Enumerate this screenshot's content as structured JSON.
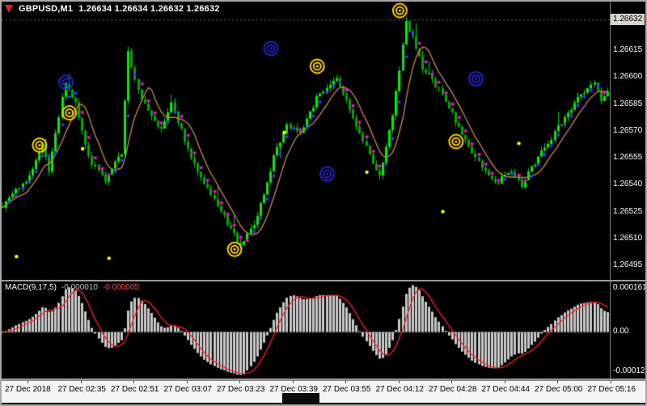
{
  "window": {
    "symbol_title": "GBPUSD,M1",
    "ohlc_title": "1.26634 1.26634 1.26632 1.26632"
  },
  "colors": {
    "background": "#000000",
    "bull": "#00ef00",
    "bear": "#00a800",
    "wick": "#00c800",
    "ma_line": "#c08050",
    "dot_up": "#2b3cff",
    "dot_down": "#ff00e0",
    "bullseye_yellow": "#ffd400",
    "bullseye_blue": "#2424cc",
    "yellow_dot": "#ffff00",
    "macd_hist": "#c8c8c8",
    "macd_signal": "#ff2020",
    "bid_line": "#6f6f6f",
    "axis_text": "#ffffff",
    "time_text": "#000000"
  },
  "chart_data": {
    "type": "candlestick",
    "title": "GBPUSD,M1",
    "symbol": "GBPUSD",
    "timeframe": "M1",
    "bars": 184,
    "bid": "1.26632",
    "p_max": 1.26642,
    "p_min": 1.26487,
    "noise_seed": 9,
    "price_grid": [
      "1.26615",
      "1.26600",
      "1.26585",
      "1.26570",
      "1.26555",
      "1.26540",
      "1.26525",
      "1.26510",
      "1.26495"
    ],
    "price_keyframes": [
      [
        0,
        1.26528
      ],
      [
        8,
        1.26545
      ],
      [
        12,
        1.26562
      ],
      [
        14,
        1.26548
      ],
      [
        19,
        1.26598
      ],
      [
        22,
        1.26585
      ],
      [
        26,
        1.26555
      ],
      [
        31,
        1.26542
      ],
      [
        36,
        1.26558
      ],
      [
        38,
        1.26615
      ],
      [
        40,
        1.26598
      ],
      [
        44,
        1.2658
      ],
      [
        48,
        1.2657
      ],
      [
        51,
        1.26585
      ],
      [
        57,
        1.26555
      ],
      [
        63,
        1.26535
      ],
      [
        70,
        1.26512
      ],
      [
        72,
        1.26505
      ],
      [
        77,
        1.26522
      ],
      [
        82,
        1.26555
      ],
      [
        86,
        1.26574
      ],
      [
        90,
        1.26568
      ],
      [
        95,
        1.26588
      ],
      [
        101,
        1.266
      ],
      [
        106,
        1.26578
      ],
      [
        111,
        1.26556
      ],
      [
        114,
        1.26544
      ],
      [
        118,
        1.2658
      ],
      [
        122,
        1.2663
      ],
      [
        124,
        1.26622
      ],
      [
        127,
        1.26605
      ],
      [
        133,
        1.2659
      ],
      [
        139,
        1.26568
      ],
      [
        144,
        1.26552
      ],
      [
        149,
        1.2654
      ],
      [
        153,
        1.26548
      ],
      [
        157,
        1.2654
      ],
      [
        162,
        1.26555
      ],
      [
        168,
        1.26572
      ],
      [
        174,
        1.26588
      ],
      [
        179,
        1.26598
      ],
      [
        181,
        1.26586
      ],
      [
        183,
        1.26592
      ]
    ],
    "markers": {
      "bullseye": [
        {
          "bar": 11,
          "price": 1.26562,
          "color": "yellow"
        },
        {
          "bar": 19,
          "price": 1.26597,
          "color": "blue"
        },
        {
          "bar": 20,
          "price": 1.2658,
          "color": "yellow"
        },
        {
          "bar": 70,
          "price": 1.26504,
          "color": "yellow"
        },
        {
          "bar": 81,
          "price": 1.26616,
          "color": "blue"
        },
        {
          "bar": 95,
          "price": 1.26606,
          "color": "yellow"
        },
        {
          "bar": 98,
          "price": 1.26546,
          "color": "blue"
        },
        {
          "bar": 120,
          "price": 1.26637,
          "color": "yellow"
        },
        {
          "bar": 137,
          "price": 1.26564,
          "color": "yellow"
        },
        {
          "bar": 143,
          "price": 1.26599,
          "color": "blue"
        }
      ],
      "yellow_dots": [
        {
          "bar": 4,
          "price": 1.265
        },
        {
          "bar": 24,
          "price": 1.2656
        },
        {
          "bar": 32,
          "price": 1.26499
        },
        {
          "bar": 85,
          "price": 1.26569
        },
        {
          "bar": 110,
          "price": 1.26547
        },
        {
          "bar": 133,
          "price": 1.26525
        },
        {
          "bar": 156,
          "price": 1.26563
        }
      ]
    },
    "overlays": {
      "ma_period": 8,
      "dot_period": 4
    },
    "macd": {
      "name_label": "MACD(9,17,5)",
      "main_value": "-0.000010",
      "signal_value": "-0.000005",
      "fast": 9,
      "slow": 17,
      "signal": 5,
      "axis_max_label": "0.000161",
      "axis_zero_label": "0.00",
      "axis_min_label": "-0.000126"
    },
    "x_labels": [
      "27 Dec 2018",
      "27 Dec 02:35",
      "27 Dec 02:51",
      "27 Dec 03:07",
      "27 Dec 03:23",
      "27 Dec 03:39",
      "27 Dec 03:55",
      "27 Dec 04:12",
      "27 Dec 04:28",
      "27 Dec 04:44",
      "27 Dec 05:00",
      "27 Dec 05:16"
    ]
  }
}
